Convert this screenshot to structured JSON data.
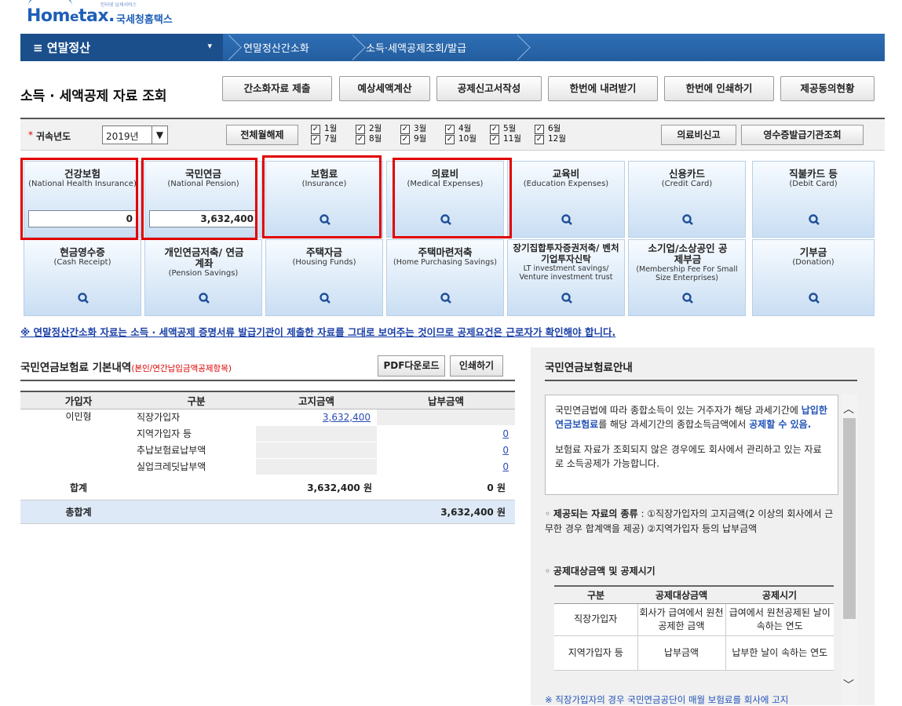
{
  "logo": {
    "brand_prefix": "Hom",
    "brand_mid": "e",
    "brand_suffix": "tax.",
    "name_kr": "국세청홈택스",
    "tagline": "인터넷 납세서비스"
  },
  "nav": {
    "menu_label": "≡  연말정산",
    "caret": "▾",
    "crumbs": [
      "연말정산간소화",
      "소득·세액공제조회/발급"
    ]
  },
  "page": {
    "title": "소득 · 세액공제 자료 조회"
  },
  "actions": [
    "간소화자료 제출",
    "예상세액계산",
    "공제신고서작성",
    "한번에 내려받기",
    "한번에 인쇄하기",
    "제공동의현황"
  ],
  "filter": {
    "required_mark": "*",
    "year_label": "귀속년도",
    "year_value": "2019년",
    "year_caret": "▼",
    "toggle_all": "전체월해제",
    "months_top": [
      "1월",
      "2월",
      "3월",
      "4월",
      "5월",
      "6월"
    ],
    "months_bottom": [
      "7월",
      "8월",
      "9월",
      "10월",
      "11월",
      "12월"
    ],
    "check": "✓",
    "medical_report": "의료비신고",
    "issuer_lookup": "영수증발급기관조회"
  },
  "tiles_row1": [
    {
      "ko": "건강보험",
      "en": "(National Health Insurance)",
      "amount": "0"
    },
    {
      "ko": "국민연금",
      "en": "(National Pension)",
      "amount": "3,632,400"
    },
    {
      "ko": "보험료",
      "en": "(Insurance)"
    },
    {
      "ko": "의료비",
      "en": "(Medical Expenses)"
    },
    {
      "ko": "교육비",
      "en": "(Education Expenses)"
    },
    {
      "ko": "신용카드",
      "en": "(Credit Card)"
    },
    {
      "ko": "직불카드 등",
      "en": "(Debit Card)"
    }
  ],
  "tiles_row2": [
    {
      "ko": "현금영수증",
      "en": "(Cash Receipt)"
    },
    {
      "ko": "개인연금저축/ 연금계좌",
      "en": "(Pension Savings)"
    },
    {
      "ko": "주택자금",
      "en": "(Housing Funds)"
    },
    {
      "ko": "주택마련저축",
      "en": "(Home Purchasing Savings)"
    },
    {
      "ko": "장기집합투자증권저축/ 벤처기업투자신탁",
      "en": "LT investment savings/ Venture investment trust"
    },
    {
      "ko": "소기업/소상공인 공제부금",
      "en": "(Membership Fee For Small Size Enterprises)"
    },
    {
      "ko": "기부금",
      "en": "(Donation)"
    }
  ],
  "notice": "※ 연말정산간소화 자료는 소득 · 세액공제 증명서류 발급기관이 제출한 자료를 그대로 보여주는 것이므로 공제요건은 근로자가 확인해야 합니다.",
  "pension": {
    "title": "국민연금보험료 기본내역",
    "subtitle": "(본인/연간납입금액공제항목)",
    "pdf_button": "PDF다운로드",
    "print_button": "인쇄하기",
    "headers": [
      "가입자",
      "구분",
      "고지금액",
      "납부금액"
    ],
    "subscriber": "이민형",
    "rows": [
      {
        "type": "직장가입자",
        "notice": "3,632,400",
        "paid": ""
      },
      {
        "type": "지역가입자 등",
        "notice": "",
        "paid": "0"
      },
      {
        "type": "추납보험료납부액",
        "notice": "",
        "paid": "0"
      },
      {
        "type": "실업크레딧납부액",
        "notice": "",
        "paid": "0"
      }
    ],
    "sum_label": "합계",
    "sum_notice": "3,632,400 원",
    "sum_paid": "0 원",
    "grand_label": "총합계",
    "grand_value": "3,632,400 원"
  },
  "guide": {
    "title": "국민연금보험료안내",
    "p1_a": "국민연금법에 따라 종합소득이 있는 거주자가 해당 과세기간에 ",
    "p1_hl1": "납입한 연금보험료",
    "p1_b": "를 해당 과세기간의 종합소득금액에서 ",
    "p1_hl2": "공제할 수 있음.",
    "p2": "보험료 자료가 조회되지 않은 경우에도 회사에서 관리하고 있는 자료로 소득공제가 가능합니다.",
    "b1_label": "제공되는 자료의 종류",
    "b1_text": " : ①직장가입자의 고지금액(2 이상의 회사에서 근무한 경우 합계액을 제공) ②지역가입자 등의 납부금액",
    "b2_label": "공제대상금액 및 공제시기",
    "bullet": "◦",
    "table_headers": [
      "구분",
      "공제대상금액",
      "공제시기"
    ],
    "table_rows": [
      [
        "직장가입자",
        "회사가 급여에서 원천공제한 금액",
        "급여에서 원천공제된 날이 속하는 연도"
      ],
      [
        "지역가입자 등",
        "납부금액",
        "납부한 날이 속하는 연도"
      ]
    ],
    "footnote": "※ 직장가입자의 경우 국민연금공단이 매월 보험료를 회사에 고지",
    "scroll_up": "︿",
    "scroll_down": "﹀"
  }
}
